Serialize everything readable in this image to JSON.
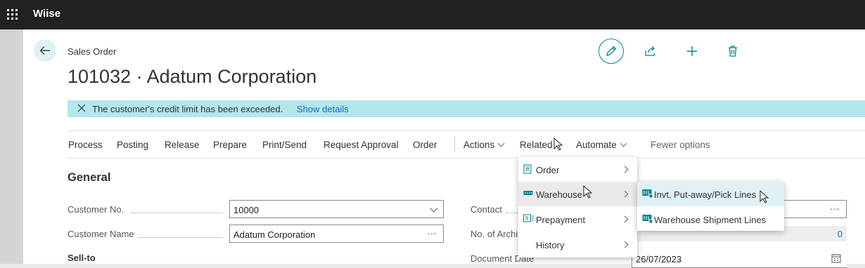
{
  "app": {
    "name": "Wiise"
  },
  "page": {
    "breadcrumb": "Sales Order",
    "title": "101032 · Adatum Corporation"
  },
  "toolbar": {
    "edit_icon": "pencil-icon",
    "share_icon": "share-icon",
    "new_icon": "plus-icon",
    "delete_icon": "trash-icon"
  },
  "notification": {
    "message": "The customer's credit limit has been exceeded.",
    "link": "Show details"
  },
  "actions": {
    "items": [
      "Process",
      "Posting",
      "Release",
      "Prepare",
      "Print/Send",
      "Request Approval",
      "Order"
    ],
    "actions_label": "Actions",
    "related_label": "Related",
    "automate_label": "Automate",
    "fewer_label": "Fewer options"
  },
  "general": {
    "heading": "General",
    "customer_no_label": "Customer No.",
    "customer_no_value": "10000",
    "customer_name_label": "Customer Name",
    "customer_name_value": "Adatum Corporation",
    "sell_to_label": "Sell-to",
    "contact_label": "Contact",
    "no_archived_label": "No. of Archi",
    "no_archived_value": "0",
    "document_date_label": "Document Date",
    "document_date_value": "26/07/2023"
  },
  "related_menu": {
    "items": [
      "Order",
      "Warehouse",
      "Prepayment",
      "History"
    ]
  },
  "warehouse_submenu": {
    "items": [
      "Invt. Put-away/Pick Lines",
      "Warehouse Shipment Lines"
    ]
  },
  "colors": {
    "accent": "#00838f",
    "notice_bg": "#b2e7ec",
    "topbar": "#212121",
    "highlight": "#dff1f4"
  }
}
